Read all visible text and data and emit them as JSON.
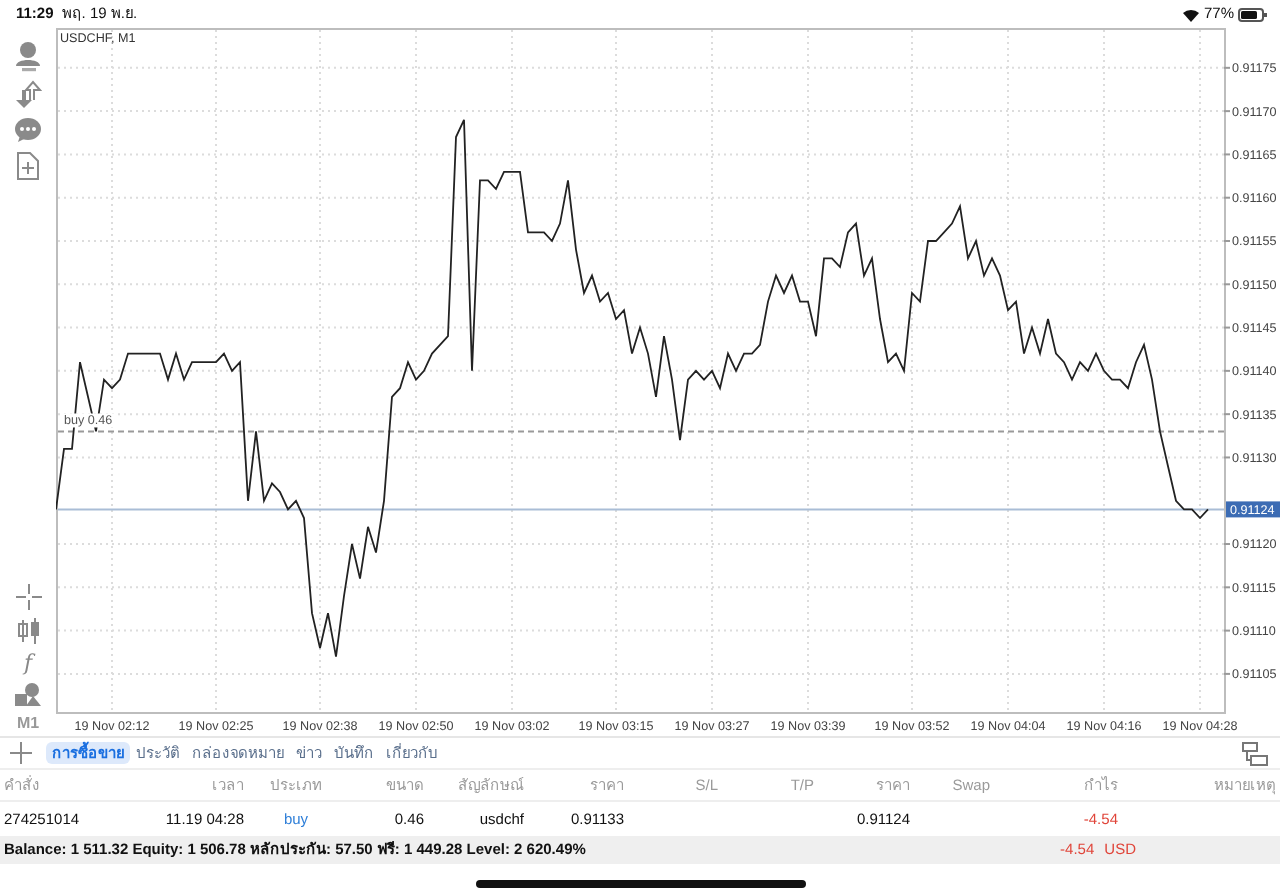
{
  "status_bar": {
    "time": "11:29",
    "date": "พฤ. 19 พ.ย.",
    "battery": "77%"
  },
  "toolbar": {
    "indicator_symbol": "f",
    "timeframe": "M1"
  },
  "chart": {
    "title": "USDCHF, M1",
    "chart_data": {
      "type": "line",
      "categories": [
        null,
        null,
        null,
        null,
        null,
        null,
        null,
        "19 Nov 02:12",
        null,
        null,
        null,
        null,
        null,
        null,
        null,
        null,
        null,
        null,
        null,
        null,
        "19 Nov 02:25",
        null,
        null,
        null,
        null,
        null,
        null,
        null,
        null,
        null,
        null,
        null,
        null,
        "19 Nov 02:38",
        null,
        null,
        null,
        null,
        null,
        null,
        null,
        null,
        null,
        null,
        null,
        "19 Nov 02:50",
        null,
        null,
        null,
        null,
        null,
        null,
        null,
        null,
        null,
        null,
        null,
        "19 Nov 03:02",
        null,
        null,
        null,
        null,
        null,
        null,
        null,
        null,
        null,
        null,
        null,
        null,
        "19 Nov 03:15",
        null,
        null,
        null,
        null,
        null,
        null,
        null,
        null,
        null,
        null,
        null,
        "19 Nov 03:27",
        null,
        null,
        null,
        null,
        null,
        null,
        null,
        null,
        null,
        null,
        null,
        "19 Nov 03:39",
        null,
        null,
        null,
        null,
        null,
        null,
        null,
        null,
        null,
        null,
        null,
        null,
        "19 Nov 03:52",
        null,
        null,
        null,
        null,
        null,
        null,
        null,
        null,
        null,
        null,
        null,
        "19 Nov 04:04",
        null,
        null,
        null,
        null,
        null,
        null,
        null,
        null,
        null,
        null,
        null,
        "19 Nov 04:16",
        null,
        null,
        null,
        null,
        null,
        null,
        null,
        null,
        null,
        null,
        null,
        "19 Nov 04:28",
        null
      ],
      "series": [
        {
          "color": "#222222",
          "values": [
            0.91124,
            0.91131,
            0.91131,
            0.91141,
            0.91137,
            0.91133,
            0.91139,
            0.91138,
            0.91139,
            0.91142,
            0.91142,
            0.91142,
            0.91142,
            0.91142,
            0.91139,
            0.91142,
            0.91139,
            0.91141,
            0.91141,
            0.91141,
            0.91141,
            0.91142,
            0.9114,
            0.91141,
            0.91125,
            0.91133,
            0.91125,
            0.91127,
            0.91126,
            0.91124,
            0.91125,
            0.91123,
            0.91112,
            0.91108,
            0.91112,
            0.91107,
            0.91114,
            0.9112,
            0.91116,
            0.91122,
            0.91119,
            0.91125,
            0.91137,
            0.91138,
            0.91141,
            0.91139,
            0.9114,
            0.91142,
            0.91143,
            0.91144,
            0.91167,
            0.91169,
            0.9114,
            0.91162,
            0.91162,
            0.91161,
            0.91163,
            0.91163,
            0.91163,
            0.91156,
            0.91156,
            0.91156,
            0.91155,
            0.91157,
            0.91162,
            0.91154,
            0.91149,
            0.91151,
            0.91148,
            0.91149,
            0.91146,
            0.91147,
            0.91142,
            0.91145,
            0.91142,
            0.91137,
            0.91144,
            0.91139,
            0.91132,
            0.91139,
            0.9114,
            0.91139,
            0.9114,
            0.91138,
            0.91142,
            0.9114,
            0.91142,
            0.91142,
            0.91143,
            0.91148,
            0.91151,
            0.91149,
            0.91151,
            0.91148,
            0.91148,
            0.91144,
            0.91153,
            0.91153,
            0.91152,
            0.91156,
            0.91157,
            0.91151,
            0.91153,
            0.91146,
            0.91141,
            0.91142,
            0.9114,
            0.91149,
            0.91148,
            0.91155,
            0.91155,
            0.91156,
            0.91157,
            0.91159,
            0.91153,
            0.91155,
            0.91151,
            0.91153,
            0.91151,
            0.91147,
            0.91148,
            0.91142,
            0.91145,
            0.91142,
            0.91146,
            0.91142,
            0.91141,
            0.91139,
            0.91141,
            0.9114,
            0.91142,
            0.9114,
            0.91139,
            0.91139,
            0.91138,
            0.91141,
            0.91143,
            0.91139,
            0.91133,
            0.91129,
            0.91125,
            0.91124,
            0.91124,
            0.91123,
            0.91124
          ]
        }
      ],
      "ylim": [
        0.911006,
        0.911796
      ],
      "yticks": [
        {
          "value": 0.91175,
          "label": "0.91175"
        },
        {
          "value": 0.9117,
          "label": "0.91170"
        },
        {
          "value": 0.91165,
          "label": "0.91165"
        },
        {
          "value": 0.9116,
          "label": "0.91160"
        },
        {
          "value": 0.91155,
          "label": "0.91155"
        },
        {
          "value": 0.9115,
          "label": "0.91150"
        },
        {
          "value": 0.91145,
          "label": "0.91145"
        },
        {
          "value": 0.9114,
          "label": "0.91140"
        },
        {
          "value": 0.91135,
          "label": "0.91135"
        },
        {
          "value": 0.9113,
          "label": "0.91130"
        },
        {
          "value": 0.9112,
          "label": "0.91120"
        },
        {
          "value": 0.91115,
          "label": "0.91115"
        },
        {
          "value": 0.9111,
          "label": "0.91110"
        },
        {
          "value": 0.91105,
          "label": "0.91105"
        }
      ],
      "grid": true,
      "ref_lines": [
        {
          "axis": "y",
          "value": 0.91133,
          "label": "buy 0.46",
          "color": "#9a9a9a"
        },
        {
          "axis": "y",
          "value": 0.91124,
          "label": "0.91124",
          "color": "#a9bdd6"
        }
      ]
    }
  },
  "tabs": [
    {
      "label": "การซื้อขาย",
      "selected": true
    },
    {
      "label": "ประวัติ",
      "selected": false
    },
    {
      "label": "กล่องจดหมาย",
      "selected": false
    },
    {
      "label": "ข่าว",
      "selected": false
    },
    {
      "label": "บันทึก",
      "selected": false
    },
    {
      "label": "เกี่ยวกับ",
      "selected": false
    }
  ],
  "table": {
    "columns": [
      "คำสั่ง",
      "เวลา",
      "ประเภท",
      "ขนาด",
      "สัญลักษณ์",
      "ราคา",
      "S/L",
      "T/P",
      "ราคา",
      "Swap",
      "กำไร",
      "หมายเหตุ"
    ],
    "rows": [
      {
        "order": "274251014",
        "time": "11.19 04:28",
        "type": "buy",
        "volume": "0.46",
        "symbol": "usdchf",
        "open_price": "0.91133",
        "current_price": "0.91124",
        "profit": "-4.54"
      }
    ]
  },
  "summary": {
    "text": "Balance: 1 511.32 Equity: 1 506.78 หลักประกัน: 57.50 ฟรี: 1 449.28 Level: 2 620.49%",
    "profit": "-4.54",
    "currency": "USD"
  }
}
